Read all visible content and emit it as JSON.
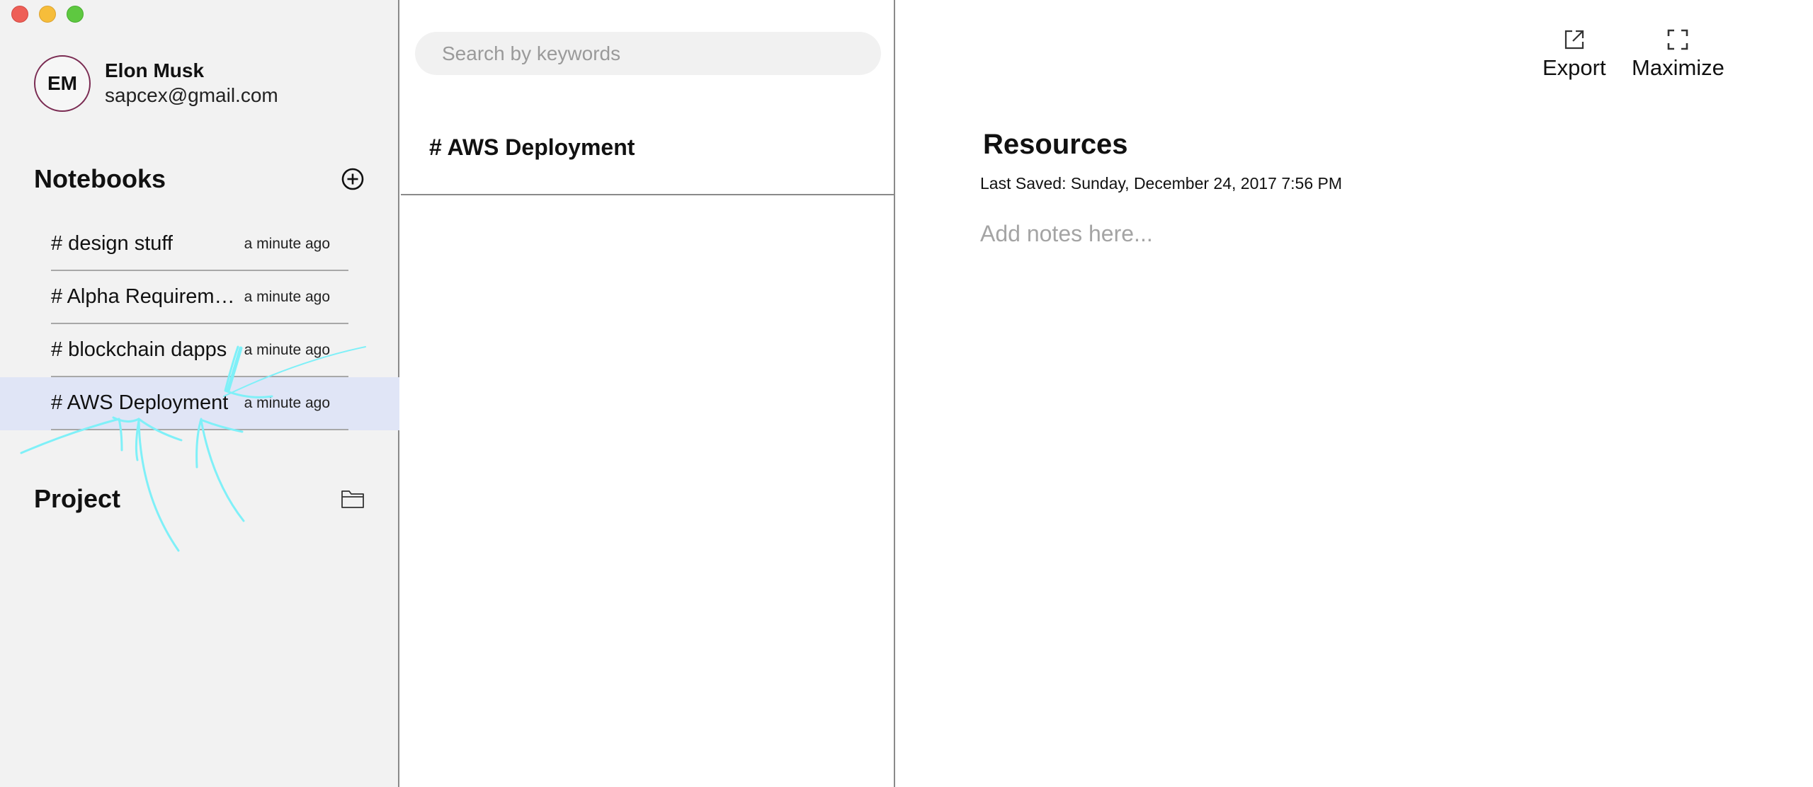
{
  "window": {
    "controls": [
      "close",
      "minimize",
      "zoom"
    ]
  },
  "user": {
    "initials": "EM",
    "name": "Elon Musk",
    "email": "sapcex@gmail.com"
  },
  "notebooks": {
    "title": "Notebooks",
    "add_icon": "plus-circle-icon",
    "items": [
      {
        "title": "# design stuff",
        "time": "a minute ago",
        "active": false
      },
      {
        "title": "# Alpha Requirements",
        "time": "a minute ago",
        "active": false
      },
      {
        "title": "# blockchain dapps",
        "time": "a minute ago",
        "active": false
      },
      {
        "title": "# AWS Deployment",
        "time": "a minute ago",
        "active": true
      }
    ]
  },
  "project": {
    "title": "Project",
    "icon": "folder-icon"
  },
  "search": {
    "placeholder": "Search by keywords",
    "value": ""
  },
  "note_list": {
    "items": [
      {
        "title": "# AWS Deployment"
      }
    ]
  },
  "toolbar": {
    "export_label": "Export",
    "maximize_label": "Maximize"
  },
  "editor": {
    "title": "Resources",
    "last_saved": "Last Saved: Sunday, December 24, 2017 7:56 PM",
    "placeholder": "Add notes here..."
  },
  "colors": {
    "sidebar_bg": "#f2f2f2",
    "active_item_bg": "#e0e5f6",
    "avatar_ring": "#7a2b52",
    "annotation_stroke": "#7ff0f8"
  }
}
